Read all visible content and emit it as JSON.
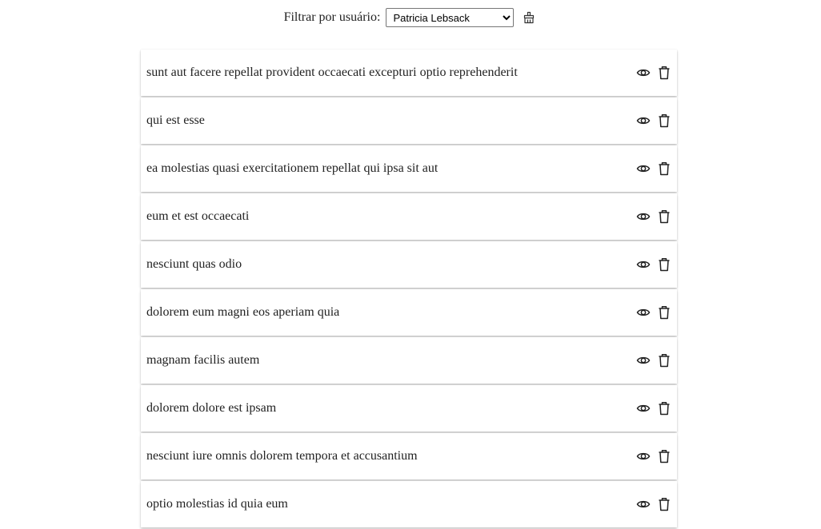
{
  "filter": {
    "label": "Filtrar por usuário:",
    "selected_user": "Patricia Lebsack",
    "clear_icon": "broom-icon"
  },
  "posts": [
    {
      "title": "sunt aut facere repellat provident occaecati excepturi optio reprehenderit"
    },
    {
      "title": "qui est esse"
    },
    {
      "title": "ea molestias quasi exercitationem repellat qui ipsa sit aut"
    },
    {
      "title": "eum et est occaecati"
    },
    {
      "title": "nesciunt quas odio"
    },
    {
      "title": "dolorem eum magni eos aperiam quia"
    },
    {
      "title": "magnam facilis autem"
    },
    {
      "title": "dolorem dolore est ipsam"
    },
    {
      "title": "nesciunt iure omnis dolorem tempora et accusantium"
    },
    {
      "title": "optio molestias id quia eum"
    }
  ],
  "icons": {
    "view": "eye-icon",
    "delete": "trash-icon"
  }
}
